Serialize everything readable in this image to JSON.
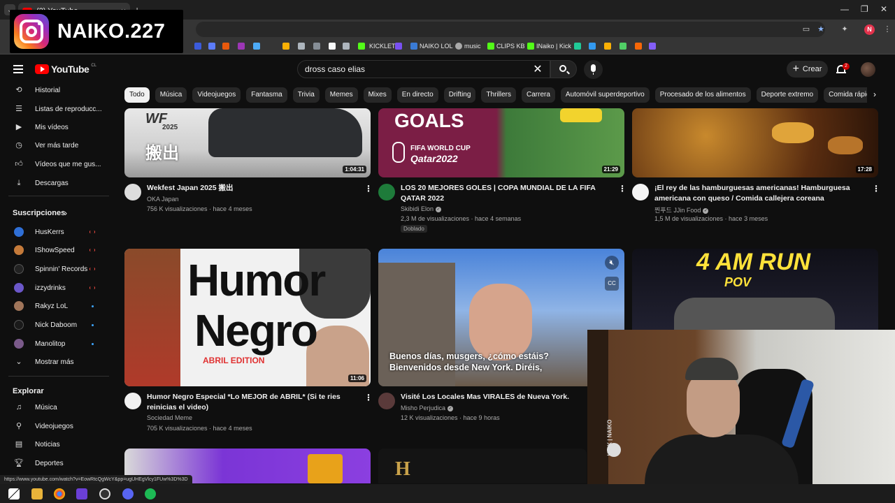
{
  "browser": {
    "tab_title": "(2) YouTube",
    "new_tab": "+",
    "tab_menu": "⌄",
    "window_controls": [
      "—",
      "❐",
      "✕"
    ],
    "bookmarks": [
      {
        "label": "KICKLET",
        "color": "#53fc18"
      },
      {
        "label": "NAIKO LOL",
        "color": "#3a7bd5"
      },
      {
        "label": "music",
        "color": "#aaaaaa"
      },
      {
        "label": "CLIPS KB",
        "color": "#53fc18"
      },
      {
        "label": "INaiko | Kick",
        "color": "#53fc18"
      }
    ],
    "profile_initial": "N",
    "status_url": "https://www.youtube.com/watch?v=EowRtcQgWcY&pp=ugUHEgVlcy1FUw%3D%3D"
  },
  "overlay": {
    "icon": "instagram-icon",
    "handle": "NAIKO.227"
  },
  "youtube": {
    "logo_text": "YouTube",
    "country_code": "CL",
    "search": {
      "value": "dross caso elias",
      "clear": "✕"
    },
    "create_label": "Crear",
    "notification_count": "2",
    "chips": [
      "Todo",
      "Música",
      "Videojuegos",
      "Fantasma",
      "Trivia",
      "Memes",
      "Mixes",
      "En directo",
      "Drifting",
      "Thrillers",
      "Carrera",
      "Automóvil superdeportivo",
      "Procesado de los alimentos",
      "Deporte extremo",
      "Comida rápida"
    ],
    "chips_next": "›",
    "sidebar": {
      "you_items": [
        {
          "label": "Historial",
          "icon": "history-icon"
        },
        {
          "label": "Listas de reproducc...",
          "icon": "playlists-icon"
        },
        {
          "label": "Mis vídeos",
          "icon": "my-videos-icon"
        },
        {
          "label": "Ver más tarde",
          "icon": "watch-later-icon"
        },
        {
          "label": "Vídeos que me gus...",
          "icon": "liked-icon"
        },
        {
          "label": "Descargas",
          "icon": "downloads-icon"
        }
      ],
      "subscriptions_heading": "Suscripciones",
      "subscriptions": [
        {
          "label": "HusKerrs",
          "color": "#2f6fd6",
          "status": "live"
        },
        {
          "label": "IShowSpeed",
          "color": "#c47a3a",
          "status": "live"
        },
        {
          "label": "Spinnin' Records",
          "color": "#222222",
          "status": "live"
        },
        {
          "label": "izzydrinks",
          "color": "#6b57c9",
          "status": "live"
        },
        {
          "label": "Rakyz LoL",
          "color": "#a0755a",
          "status": "new"
        },
        {
          "label": "Nick Daboom",
          "color": "#1a1a1a",
          "status": "new"
        },
        {
          "label": "Manolitop",
          "color": "#7a5a8a",
          "status": "new"
        }
      ],
      "show_more": "Mostrar más",
      "explore_heading": "Explorar",
      "explore": [
        {
          "label": "Música",
          "icon": "music-icon"
        },
        {
          "label": "Videojuegos",
          "icon": "gaming-icon"
        },
        {
          "label": "Noticias",
          "icon": "news-icon"
        },
        {
          "label": "Deportes",
          "icon": "sports-icon"
        }
      ]
    },
    "videos": [
      {
        "title": "Wekfest Japan 2025 搬出",
        "channel": "OKA Japan",
        "verified": false,
        "meta": "756 K visualizaciones · hace 4 meses",
        "duration": "1:04:31",
        "thumb_texts": [
          "2025",
          "搬出"
        ]
      },
      {
        "title": "LOS 20 MEJORES GOLES | COPA MUNDIAL DE LA FIFA QATAR 2022",
        "channel": "Skibidi Elon",
        "verified": true,
        "meta": "2,3 M de visualizaciones · hace 4 semanas",
        "badge": "Doblado",
        "duration": "21:29",
        "thumb_texts": [
          "GOALS",
          "FIFA WORLD CUP",
          "Qatar2022"
        ]
      },
      {
        "title": "¡El rey de las hamburguesas americanas! Hamburguesa americana con queso / Comida callejera coreana",
        "channel": "찐푸드 JJin Food",
        "verified": true,
        "meta": "1,5 M de visualizaciones · hace 3 meses",
        "duration": "17:28"
      },
      {
        "title": "Humor Negro Especial *Lo MEJOR de ABRIL* (Si te ries reinicias el video)",
        "channel": "Sociedad Meme",
        "verified": false,
        "meta": "705 K visualizaciones · hace 4 meses",
        "duration": "11:06",
        "thumb_texts": [
          "Humor",
          "Negro",
          "ABRIL EDITION"
        ]
      },
      {
        "title": "Visité Los Locales Mas VIRALES de Nueva York.",
        "channel": "Misho Perjudica",
        "verified": true,
        "meta": "12 K visualizaciones · hace 9 horas",
        "caption": [
          "Buenos días, musgers, ¿cómo estáis?",
          "Bienvenidos desde New York. Diréis,"
        ]
      },
      {
        "title": "",
        "thumb_texts": [
          "4 AM RUN",
          "POV"
        ]
      },
      {
        "thumb_texts": [
          "H"
        ]
      }
    ]
  },
  "webcam": {
    "sign_text": "KICK | NAIKO"
  }
}
